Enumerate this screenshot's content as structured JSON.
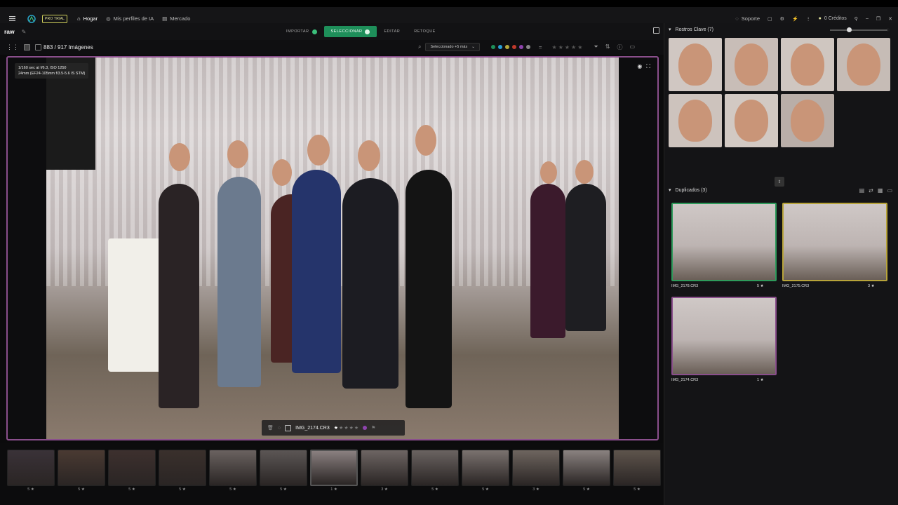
{
  "topbar": {
    "trial_badge": "PRO TRIAL",
    "nav": [
      {
        "label": "Hogar",
        "icon": "home-icon",
        "active": true
      },
      {
        "label": "Mis perfiles de IA",
        "icon": "ai-profile-icon",
        "active": false
      },
      {
        "label": "Mercado",
        "icon": "market-icon",
        "active": false
      }
    ],
    "support": "Soporte",
    "credits": "0 Créditos"
  },
  "subbar": {
    "project": "raw",
    "modes": [
      {
        "label": "IMPORTAR",
        "state": "done"
      },
      {
        "label": "SELECCIONAR",
        "state": "selected"
      },
      {
        "label": "EDITAR",
        "state": "none"
      },
      {
        "label": "RETOQUE",
        "state": "none"
      }
    ]
  },
  "toolbar": {
    "count": "883 / 917 Imágenes",
    "selection_dropdown": "Seleccionado +5 más",
    "color_dots": [
      "#1e8f5a",
      "#2a9fd6",
      "#b5a83a",
      "#c0392b",
      "#8e44ad",
      "#888888"
    ]
  },
  "viewer": {
    "exif_line1": "1/160 sec at f/6.3, ISO 1250",
    "exif_line2": "24mm (EF24-105mm f/3.5-5.6 IS STM)",
    "filename": "IMG_2174.CR3",
    "rating": 1
  },
  "filmstrip": {
    "thumbs": [
      {
        "rating": "5 ★",
        "tone": "#3a3238"
      },
      {
        "rating": "5 ★",
        "tone": "#4a3a32"
      },
      {
        "rating": "5 ★",
        "tone": "#3d302e"
      },
      {
        "rating": "5 ★",
        "tone": "#3a302c"
      },
      {
        "rating": "5 ★",
        "tone": "#6a6260"
      },
      {
        "rating": "5 ★",
        "tone": "#5c5655"
      },
      {
        "rating": "1 ★",
        "tone": "#8a8080"
      },
      {
        "rating": "3 ★",
        "tone": "#6d6563"
      },
      {
        "rating": "5 ★",
        "tone": "#6a6361"
      },
      {
        "rating": "5 ★",
        "tone": "#7a726f"
      },
      {
        "rating": "3 ★",
        "tone": "#6e655f"
      },
      {
        "rating": "5 ★",
        "tone": "#8a8280"
      },
      {
        "rating": "5 ★",
        "tone": "#5e544c"
      }
    ]
  },
  "right": {
    "faces_title": "Rostros Clave (7)",
    "faces": [
      {
        "name": "face-1",
        "bg": "#d0c7c2"
      },
      {
        "name": "face-2",
        "bg": "#c8bdb7"
      },
      {
        "name": "face-3",
        "bg": "#cfc6c0"
      },
      {
        "name": "face-4",
        "bg": "#c6bcb6"
      },
      {
        "name": "face-5",
        "bg": "#cdc3bd"
      },
      {
        "name": "face-6",
        "bg": "#d2c9c3"
      },
      {
        "name": "face-7",
        "bg": "#b9aea8"
      }
    ],
    "dup_title": "Duplicados (3)",
    "duplicates": [
      {
        "file": "IMG_2178.CR3",
        "rating": "5 ★",
        "border": "#2e9b5b"
      },
      {
        "file": "IMG_2175.CR3",
        "rating": "3 ★",
        "border": "#b8a43a"
      },
      {
        "file": "IMG_2174.CR3",
        "rating": "1 ★",
        "border": "#8a4f8c"
      }
    ]
  }
}
